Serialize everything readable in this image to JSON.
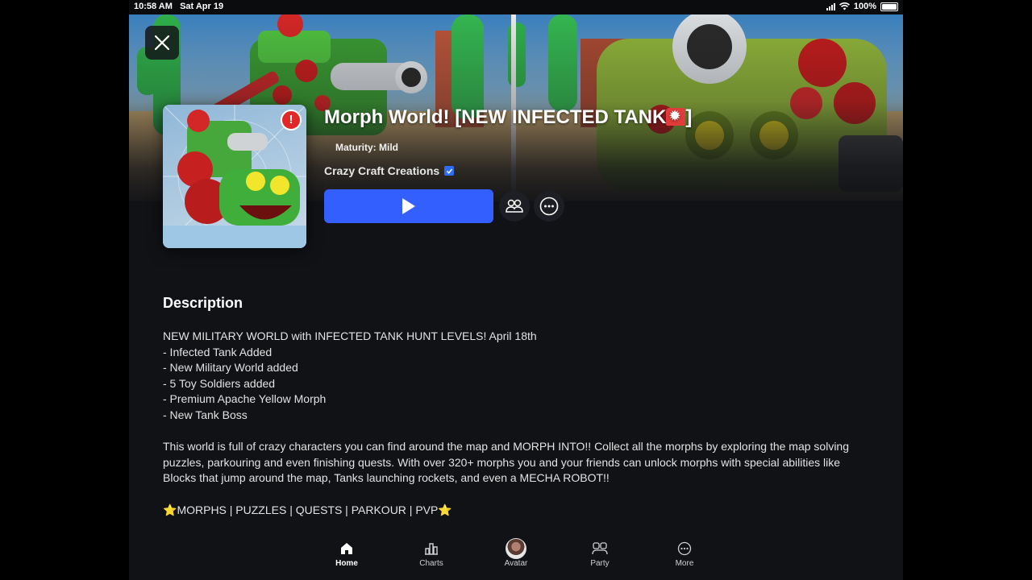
{
  "status_bar": {
    "time": "10:58 AM",
    "date": "Sat Apr 19",
    "battery": "100%"
  },
  "game": {
    "title": "Morph World! [NEW INFECTED TANK",
    "title_end": "]",
    "maturity": "Maturity: Mild",
    "creator": "Crazy Craft Creations",
    "thumbnail_badge": "!"
  },
  "description": {
    "heading": "Description",
    "lines": [
      "NEW MILITARY WORLD with INFECTED TANK HUNT LEVELS! April 18th",
      "- Infected Tank Added",
      "- New Military World added",
      "- 5 Toy Soldiers added",
      "- Premium Apache Yellow Morph",
      "- New Tank Boss"
    ],
    "paragraph": "This world is full of crazy characters you can find around the map and MORPH INTO!! Collect all the morphs by exploring the map solving puzzles, parkouring and even finishing quests. With over 320+ morphs you and your friends can unlock morphs with special abilities like Blocks that jump around the map, Tanks launching rockets, and even a MECHA ROBOT!!",
    "tags_star": "⭐",
    "tags": "MORPHS | PUZZLES | QUESTS | PARKOUR | PVP"
  },
  "nav": {
    "home": "Home",
    "charts": "Charts",
    "avatar": "Avatar",
    "party": "Party",
    "more": "More"
  },
  "icons": {
    "close": "close-icon",
    "play": "play-icon",
    "friends": "friends-icon",
    "more": "more-options-icon"
  },
  "colors": {
    "play_button": "#335fff",
    "background": "#111216",
    "verified": "#2d6cf5"
  }
}
